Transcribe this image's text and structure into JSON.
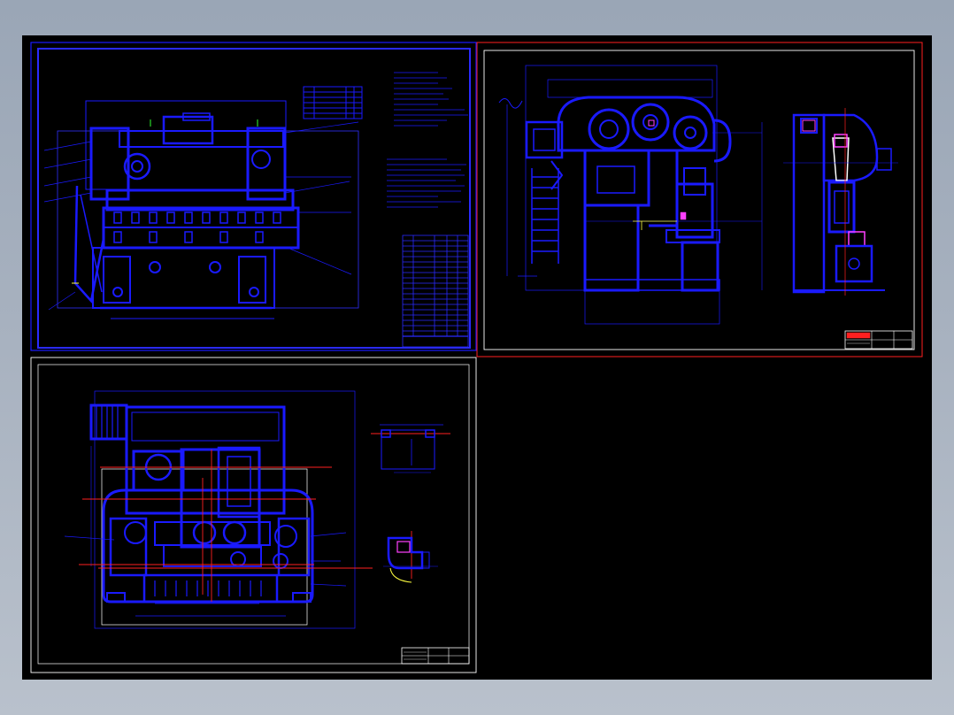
{
  "app": {
    "type": "cad-drawing-viewer",
    "background_color": "#000000",
    "primary_line_color": "#1a1aff",
    "secondary_line_color": "#ffffff",
    "center_line_color": "#ff2020",
    "highlight_color": "#ff40ff"
  },
  "sheets": [
    {
      "id": "sheet-front-view",
      "selected": false
    },
    {
      "id": "sheet-side-view",
      "selected": true
    },
    {
      "id": "sheet-plan-view",
      "selected": false
    }
  ]
}
